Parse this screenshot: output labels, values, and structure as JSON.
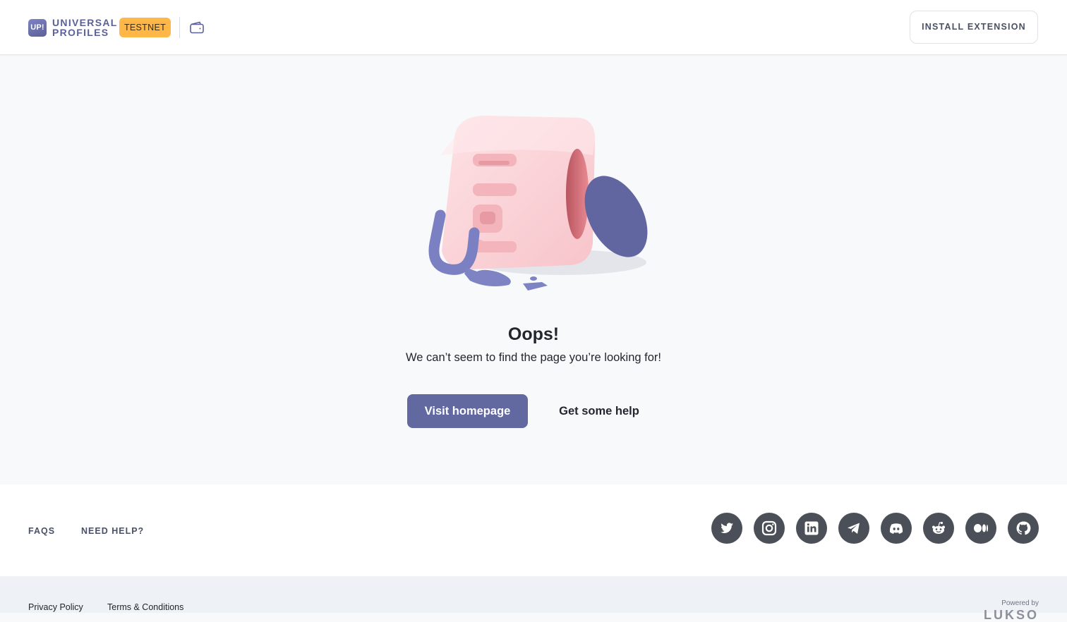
{
  "header": {
    "logo_mark": "UP!",
    "logo_line1": "UNIVERSAL",
    "logo_line2": "PROFILES",
    "network_badge": "TESTNET",
    "install_button": "INSTALL EXTENSION"
  },
  "main": {
    "title": "Oops!",
    "subtitle": "We can’t seem to find the page you’re looking for!",
    "primary_button": "Visit homepage",
    "secondary_button": "Get some help"
  },
  "footer": {
    "links": [
      "FAQS",
      "NEED HELP?"
    ],
    "social_icons": [
      "twitter-icon",
      "instagram-icon",
      "linkedin-icon",
      "telegram-icon",
      "discord-icon",
      "reddit-icon",
      "medium-icon",
      "github-icon"
    ],
    "legal_links": [
      "Privacy Policy",
      "Terms & Conditions"
    ],
    "powered_by": "Powered by",
    "powered_brand": "LUKSO"
  },
  "colors": {
    "accent": "#6268a0",
    "badge": "#ffb747",
    "cube": "#fcd3d8",
    "social_bg": "#4b4f57"
  }
}
